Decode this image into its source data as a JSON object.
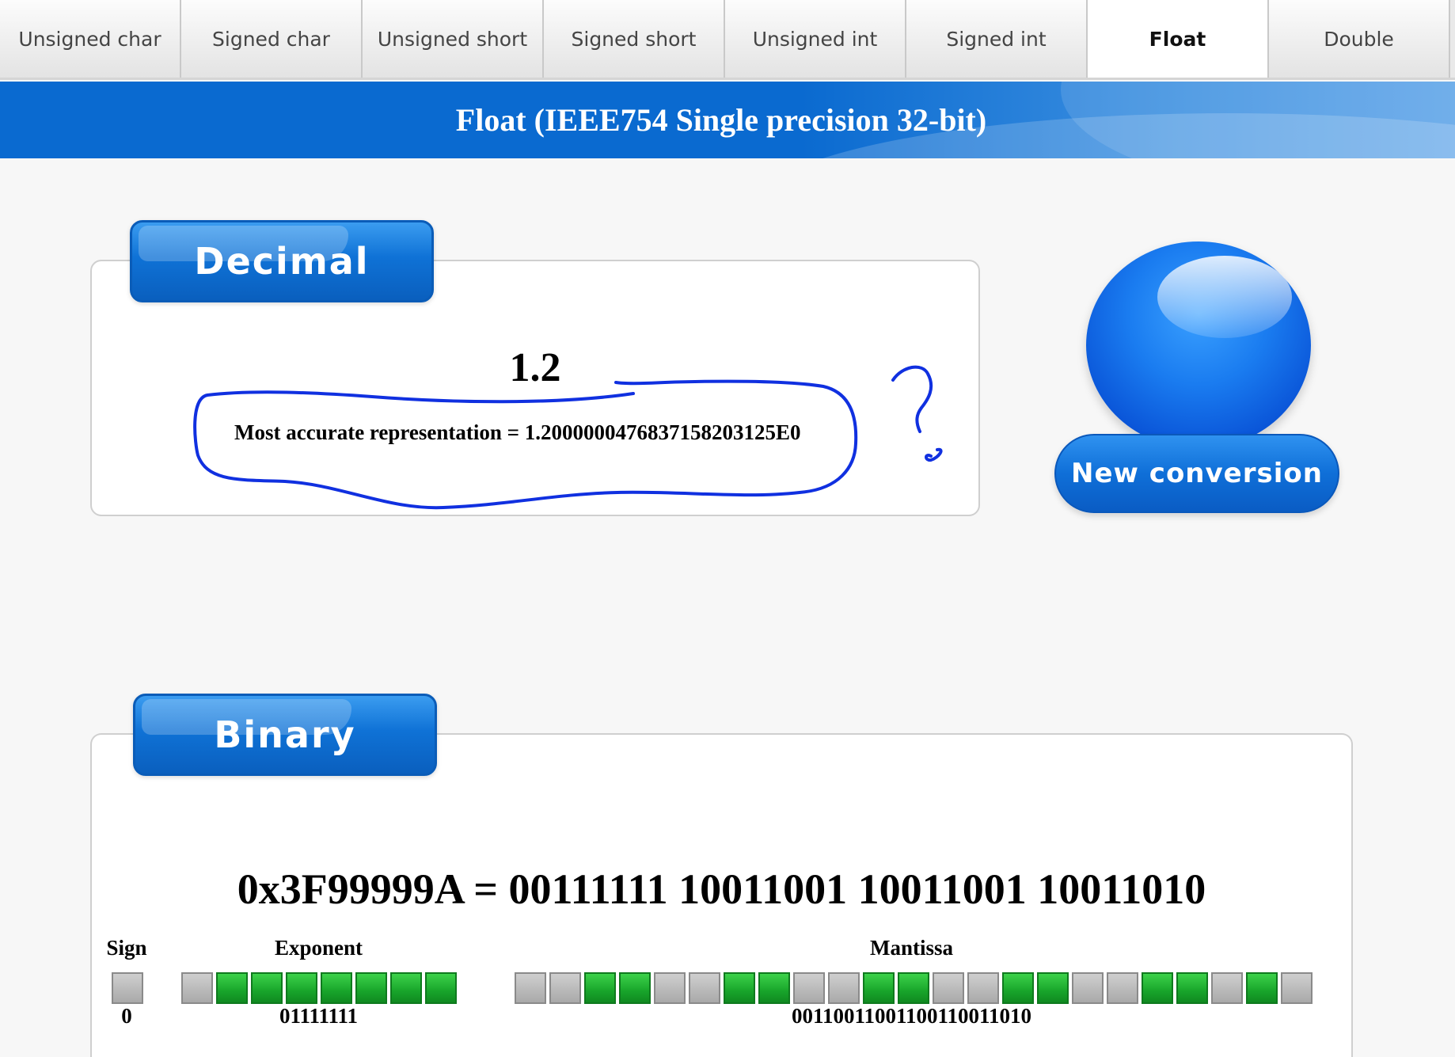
{
  "tabs": [
    {
      "label": "Unsigned char",
      "active": false
    },
    {
      "label": "Signed char",
      "active": false
    },
    {
      "label": "Unsigned short",
      "active": false
    },
    {
      "label": "Signed short",
      "active": false
    },
    {
      "label": "Unsigned int",
      "active": false
    },
    {
      "label": "Signed int",
      "active": false
    },
    {
      "label": "Float",
      "active": true
    },
    {
      "label": "Double",
      "active": false
    }
  ],
  "header": {
    "title": "Float (IEEE754 Single precision 32-bit)"
  },
  "decimal": {
    "label": "Decimal",
    "value": "1.2",
    "accurate": "Most accurate representation = 1.2000000476837158203125E0"
  },
  "new_conversion": {
    "label": "New conversion"
  },
  "binary": {
    "label": "Binary",
    "hex_line": "0x3F99999A = 00111111 10011001 10011001 10011010",
    "sign": {
      "heading": "Sign",
      "value": "0"
    },
    "exponent": {
      "heading": "Exponent",
      "value": "01111111"
    },
    "mantissa": {
      "heading": "Mantissa",
      "value": "00110011001100110011010"
    }
  },
  "colors": {
    "accent": "#0a6ad0",
    "bit_on": "#18a52b",
    "bit_off": "#b5b5b5",
    "annotation": "#1030e0"
  }
}
